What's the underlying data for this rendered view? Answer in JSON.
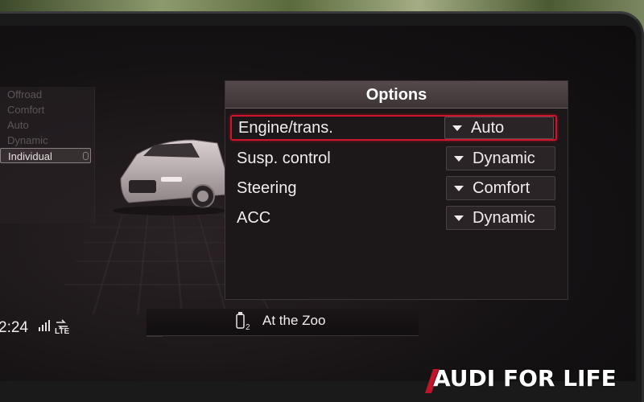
{
  "drive_select": {
    "items": [
      {
        "label": "Offroad"
      },
      {
        "label": "Comfort"
      },
      {
        "label": "Auto"
      },
      {
        "label": "Dynamic"
      },
      {
        "label": "Individual"
      }
    ],
    "selected": "Individual"
  },
  "options_panel": {
    "title": "Options",
    "rows": [
      {
        "label": "Engine/trans.",
        "value": "Auto",
        "focused": true
      },
      {
        "label": "Susp. control",
        "value": "Dynamic",
        "focused": false
      },
      {
        "label": "Steering",
        "value": "Comfort",
        "focused": false
      },
      {
        "label": "ACC",
        "value": "Dynamic",
        "focused": false
      }
    ]
  },
  "status_bar": {
    "clock": "2:24",
    "network": "LTE",
    "media_source_index": "2",
    "media_title": "At the Zoo"
  },
  "watermark": {
    "text": "AUDI FOR LIFE"
  },
  "colors": {
    "focus_accent": "#d0142a",
    "panel_header": "#4a4042",
    "text": "#f2ecec"
  },
  "icons": [
    "signal-bars-icon",
    "lte-icon",
    "usb-icon",
    "dropdown-arrow-icon"
  ]
}
